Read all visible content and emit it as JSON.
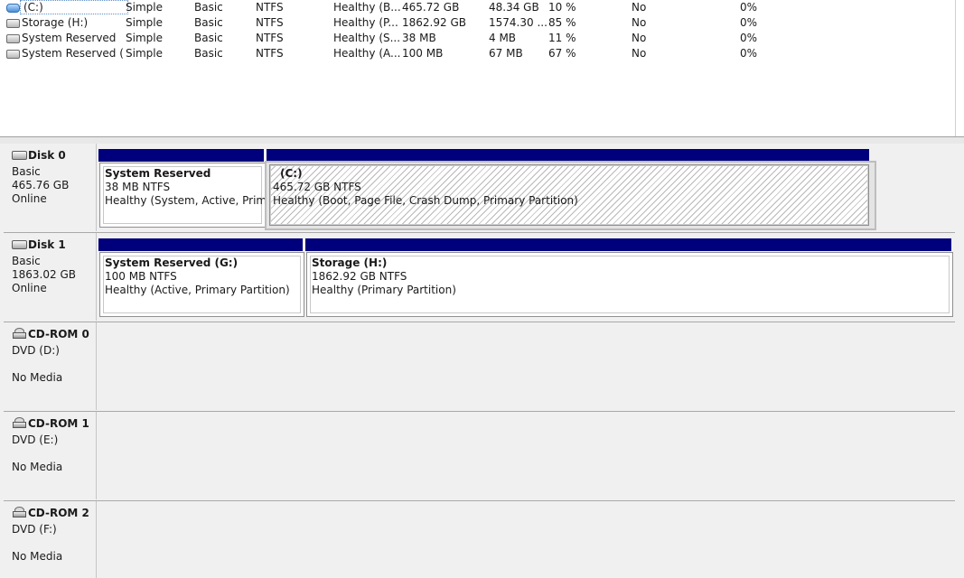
{
  "volumes": [
    {
      "name": "(C:)",
      "layout": "Simple",
      "type": "Basic",
      "fs": "NTFS",
      "status": "Healthy (B...",
      "capacity": "465.72 GB",
      "free": "48.34 GB",
      "pct": "10 %",
      "fault": "No",
      "overhead": "0%",
      "selected": true
    },
    {
      "name": "Storage (H:)",
      "layout": "Simple",
      "type": "Basic",
      "fs": "NTFS",
      "status": "Healthy (P...",
      "capacity": "1862.92 GB",
      "free": "1574.30 ...",
      "pct": "85 %",
      "fault": "No",
      "overhead": "0%"
    },
    {
      "name": "System Reserved",
      "layout": "Simple",
      "type": "Basic",
      "fs": "NTFS",
      "status": "Healthy (S...",
      "capacity": "38 MB",
      "free": "4 MB",
      "pct": "11 %",
      "fault": "No",
      "overhead": "0%"
    },
    {
      "name": "System Reserved (...",
      "layout": "Simple",
      "type": "Basic",
      "fs": "NTFS",
      "status": "Healthy (A...",
      "capacity": "100 MB",
      "free": "67 MB",
      "pct": "67 %",
      "fault": "No",
      "overhead": "0%"
    }
  ],
  "disks": [
    {
      "title": "Disk 0",
      "line1": "Basic",
      "line2": "465.76 GB",
      "line3": "Online",
      "partitions": [
        {
          "name": "System Reserved",
          "size": "38 MB NTFS",
          "status": "Healthy (System, Active, Primary"
        },
        {
          "name": "(C:)",
          "size": "465.72 GB NTFS",
          "status": "Healthy (Boot, Page File, Crash Dump, Primary Partition)"
        }
      ]
    },
    {
      "title": "Disk 1",
      "line1": "Basic",
      "line2": "1863.02 GB",
      "line3": "Online",
      "partitions": [
        {
          "name": "System Reserved  (G:)",
          "size": "100 MB NTFS",
          "status": "Healthy (Active, Primary Partition)"
        },
        {
          "name": "Storage  (H:)",
          "size": "1862.92 GB NTFS",
          "status": "Healthy (Primary Partition)"
        }
      ]
    }
  ],
  "cdroms": [
    {
      "title": "CD-ROM 0",
      "line1": "DVD (D:)",
      "line2": "No Media"
    },
    {
      "title": "CD-ROM 1",
      "line1": "DVD (E:)",
      "line2": "No Media"
    },
    {
      "title": "CD-ROM 2",
      "line1": "DVD (F:)",
      "line2": "No Media"
    }
  ],
  "colors": {
    "partition_bar": "#00007c",
    "pane_bg": "#f0f0f0",
    "selection_border": "#5d8ec9"
  },
  "icons": {
    "volume": "volume-icon",
    "disk": "hard-disk-icon",
    "cdrom": "cd-rom-drive-icon"
  }
}
